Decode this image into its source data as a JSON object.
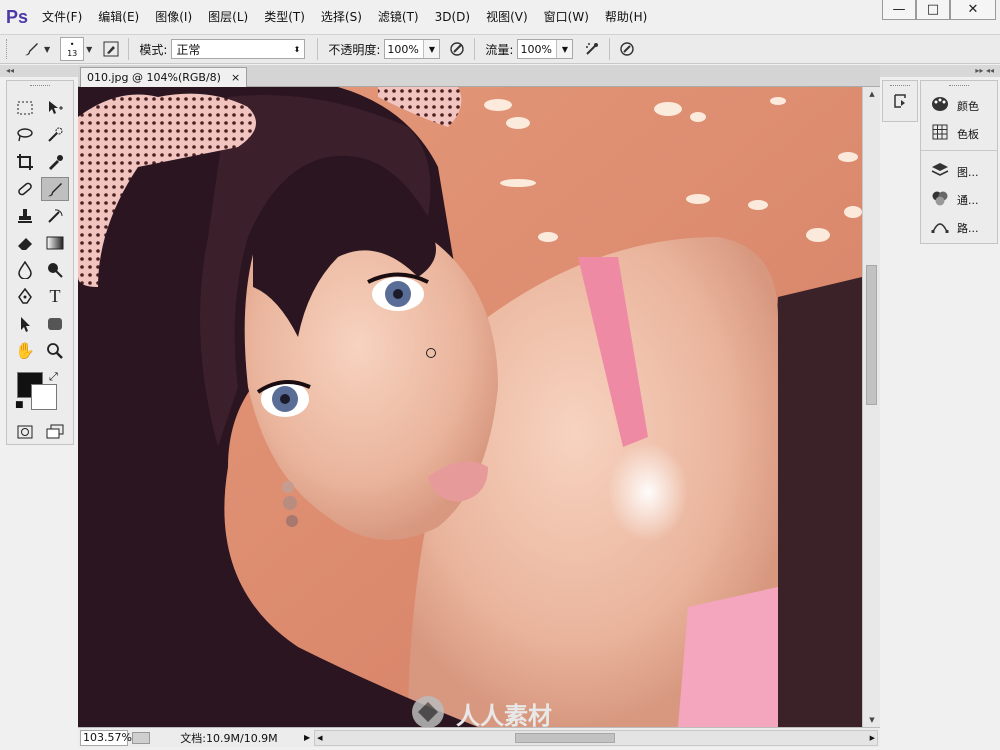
{
  "app": {
    "logo": "Ps",
    "menus": [
      "文件(F)",
      "编辑(E)",
      "图像(I)",
      "图层(L)",
      "类型(T)",
      "选择(S)",
      "滤镜(T)",
      "3D(D)",
      "视图(V)",
      "窗口(W)",
      "帮助(H)"
    ],
    "window_controls": {
      "minimize": "—",
      "maximize": "□",
      "close": "✕"
    }
  },
  "options_bar": {
    "brush_size": "13",
    "mode_label": "模式:",
    "mode_value": "正常",
    "opacity_label": "不透明度:",
    "opacity_value": "100%",
    "flow_label": "流量:",
    "flow_value": "100%"
  },
  "toolbox": {
    "collapse": "◂◂"
  },
  "document": {
    "tab_title": "010.jpg @ 104%(RGB/8)",
    "tab_close": "×",
    "watermark": "人人素材"
  },
  "status": {
    "zoom": "103.57%",
    "doc_info": "文档:10.9M/10.9M"
  },
  "right_panels": {
    "collapse": "▸▸ ◂◂",
    "items": [
      {
        "icon": "palette-icon",
        "label": "颜色"
      },
      {
        "icon": "swatches-icon",
        "label": "色板"
      },
      {
        "icon": "layers-icon",
        "label": "图..."
      },
      {
        "icon": "channels-icon",
        "label": "通..."
      },
      {
        "icon": "paths-icon",
        "label": "路..."
      }
    ]
  }
}
